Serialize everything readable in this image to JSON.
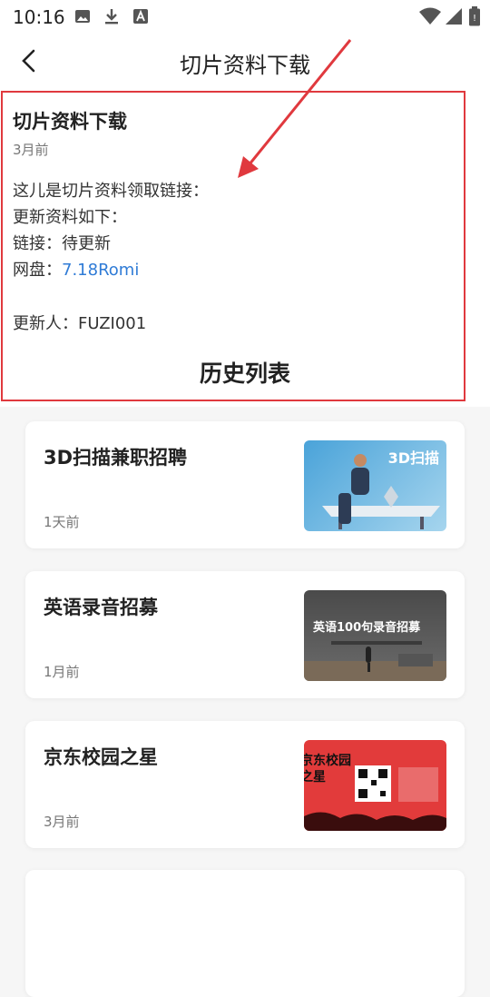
{
  "status": {
    "time": "10:16"
  },
  "header": {
    "title": "切片资料下载"
  },
  "article": {
    "title": "切片资料下载",
    "time": "3月前",
    "lines": [
      "这儿是切片资料领取链接：",
      "更新资料如下：",
      "链接：待更新"
    ],
    "pan_label": "网盘：",
    "pan_link": "7.18Romi",
    "updater": "更新人：FUZI001"
  },
  "history_heading": "历史列表",
  "history": [
    {
      "title": "3D扫描兼职招聘",
      "time": "1天前",
      "thumb_text": "3D扫描"
    },
    {
      "title": "英语录音招募",
      "time": "1月前",
      "thumb_text": "英语100句录音招募"
    },
    {
      "title": "京东校园之星",
      "time": "3月前",
      "thumb_text": "京东校园之星"
    }
  ],
  "colors": {
    "accent_red": "#e0393e",
    "link_blue": "#2f7bd6"
  }
}
